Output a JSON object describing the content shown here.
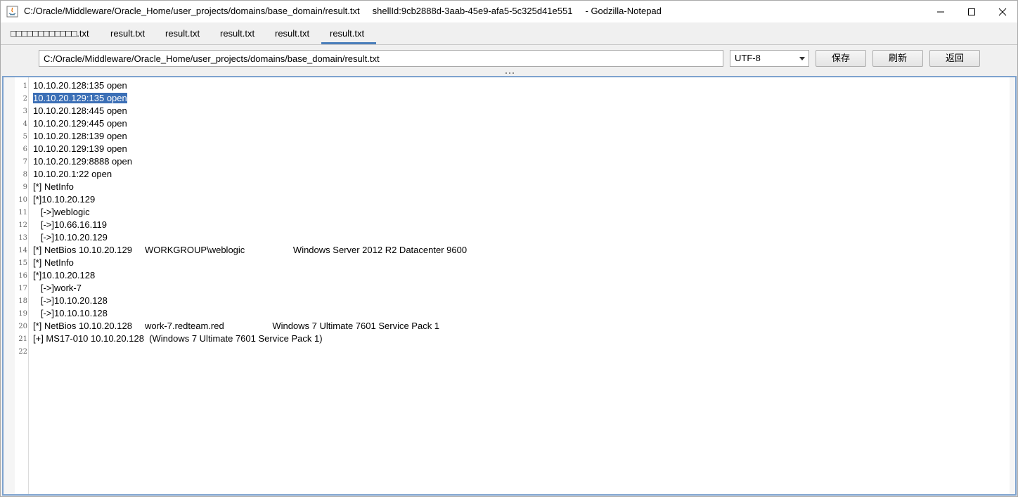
{
  "window": {
    "title": "C:/Oracle/Middleware/Oracle_Home/user_projects/domains/base_domain/result.txt     shellId:9cb2888d-3aab-45e9-afa5-5c325d41e551     - Godzilla-Notepad",
    "controls": {
      "minimize": "minimize-icon",
      "maximize": "maximize-icon",
      "close": "close-icon"
    }
  },
  "tabs": [
    {
      "label": "□□□□□□□□□□□□.txt"
    },
    {
      "label": "result.txt"
    },
    {
      "label": "result.txt"
    },
    {
      "label": "result.txt"
    },
    {
      "label": "result.txt"
    },
    {
      "label": "result.txt",
      "active": true
    }
  ],
  "toolbar": {
    "path": "C:/Oracle/Middleware/Oracle_Home/user_projects/domains/base_domain/result.txt",
    "encoding": "UTF-8",
    "save_label": "保存",
    "refresh_label": "刷新",
    "back_label": "返回"
  },
  "editor": {
    "selected_line": 2,
    "accent_color": "#3b6fb6",
    "lines": [
      "10.10.20.128:135 open",
      "10.10.20.129:135 open",
      "10.10.20.128:445 open",
      "10.10.20.129:445 open",
      "10.10.20.128:139 open",
      "10.10.20.129:139 open",
      "10.10.20.129:8888 open",
      "10.10.20.1:22 open",
      "[*] NetInfo",
      "[*]10.10.20.129",
      "   [->]weblogic",
      "   [->]10.66.16.119",
      "   [->]10.10.20.129",
      "[*] NetBios 10.10.20.129     WORKGROUP\\weblogic                   Windows Server 2012 R2 Datacenter 9600",
      "[*] NetInfo",
      "[*]10.10.20.128",
      "   [->]work-7",
      "   [->]10.10.20.128",
      "   [->]10.10.10.128",
      "[*] NetBios 10.10.20.128     work-7.redteam.red                   Windows 7 Ultimate 7601 Service Pack 1",
      "[+] MS17-010 10.10.20.128  (Windows 7 Ultimate 7601 Service Pack 1)",
      ""
    ]
  }
}
